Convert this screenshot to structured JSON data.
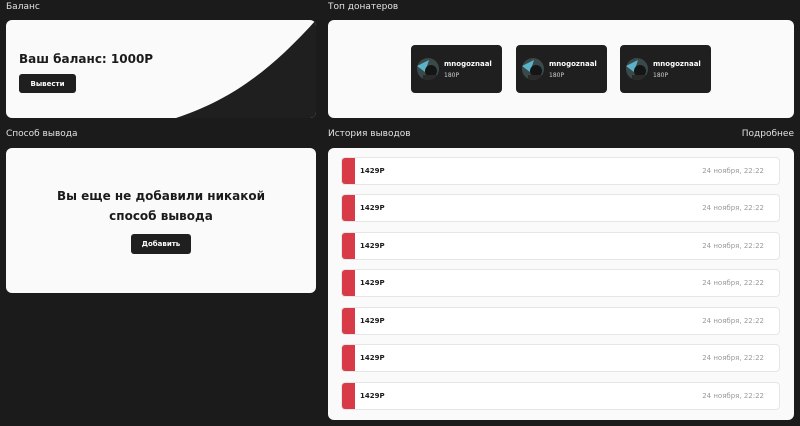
{
  "balance": {
    "section_title": "Баланс",
    "text": "Ваш баланс: 1000Р",
    "withdraw_label": "Вывести"
  },
  "top_donaters": {
    "section_title": "Топ донатеров",
    "items": [
      {
        "name": "mnogoznaal",
        "amount": "180Р",
        "avatar": "avatar-icon"
      },
      {
        "name": "mnogoznaal",
        "amount": "180Р",
        "avatar": "avatar-icon"
      },
      {
        "name": "mnogoznaal",
        "amount": "180Р",
        "avatar": "avatar-icon"
      }
    ]
  },
  "payout_method": {
    "section_title": "Способ вывода",
    "empty_line1": "Вы еще не добавили никакой",
    "empty_line2": "способ вывода",
    "add_label": "Добавить"
  },
  "history": {
    "section_title": "История выводов",
    "more_label": "Подробнее",
    "rows": [
      {
        "amount": "1429Р",
        "date": "24 ноября, 22:22"
      },
      {
        "amount": "1429Р",
        "date": "24 ноября, 22:22"
      },
      {
        "amount": "1429Р",
        "date": "24 ноября, 22:22"
      },
      {
        "amount": "1429Р",
        "date": "24 ноября, 22:22"
      },
      {
        "amount": "1429Р",
        "date": "24 ноября, 22:22"
      },
      {
        "amount": "1429Р",
        "date": "24 ноября, 22:22"
      },
      {
        "amount": "1429Р",
        "date": "24 ноября, 22:22"
      }
    ]
  },
  "colors": {
    "background": "#1b1b1b",
    "card": "#fafafa",
    "dark": "#1f1f1f",
    "accent_red": "#d83a48"
  }
}
